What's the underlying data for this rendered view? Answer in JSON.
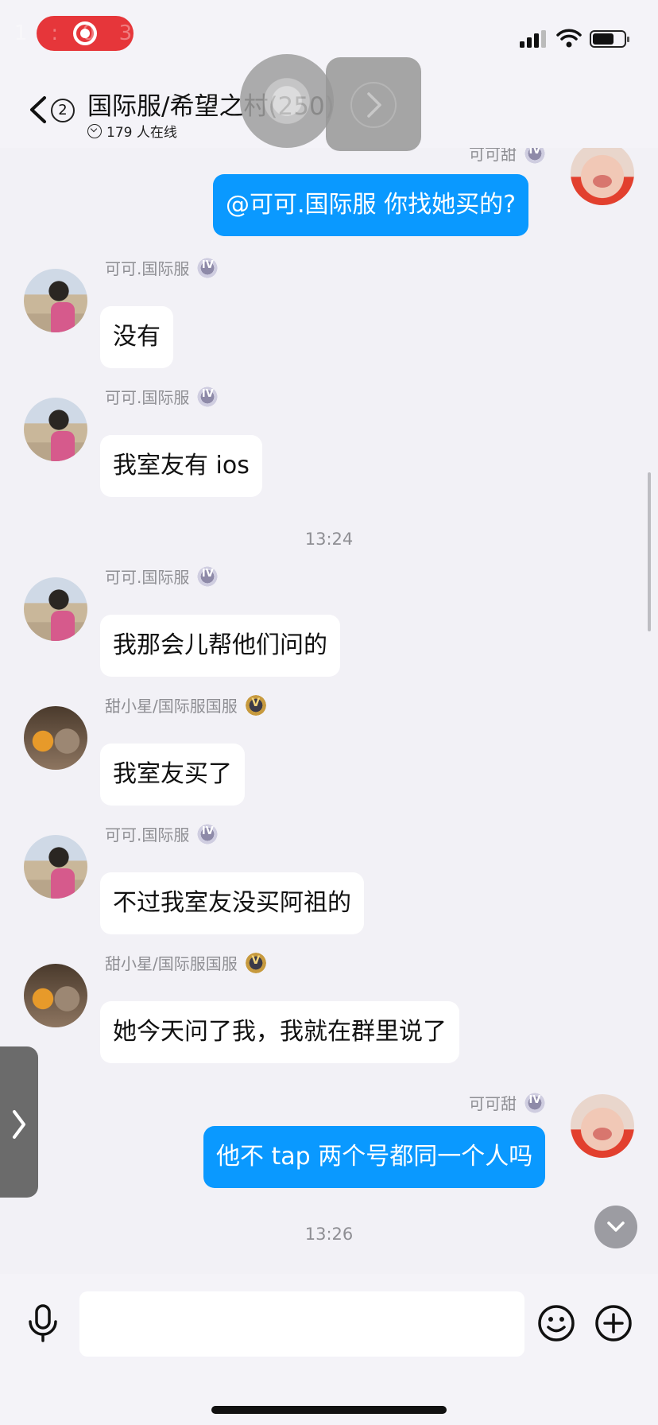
{
  "status_bar": {
    "recording_label": "1:03"
  },
  "header": {
    "unread_count": "2",
    "title": "国际服/希望之村(250)",
    "online": "179 人在线"
  },
  "chat": {
    "partial_sender": "可可甜",
    "messages": [
      {
        "side": "out",
        "sender": "",
        "badge": "silver",
        "avatar": "me",
        "text": "@可可.国际服 你找她买的?"
      },
      {
        "side": "in",
        "sender": "可可.国际服",
        "badge": "silver",
        "avatar": "koko",
        "text": "没有"
      },
      {
        "side": "in",
        "sender": "可可.国际服",
        "badge": "silver",
        "avatar": "koko",
        "text": "我室友有 ios"
      },
      {
        "time": "13:24"
      },
      {
        "side": "in",
        "sender": "可可.国际服",
        "badge": "silver",
        "avatar": "koko",
        "text": "我那会儿帮他们问的"
      },
      {
        "side": "in",
        "sender": "甜小星/国际服国服",
        "badge": "gold",
        "avatar": "tian",
        "text": "我室友买了"
      },
      {
        "side": "in",
        "sender": "可可.国际服",
        "badge": "silver",
        "avatar": "koko",
        "text": "不过我室友没买阿祖的"
      },
      {
        "side": "in",
        "sender": "甜小星/国际服国服",
        "badge": "gold",
        "avatar": "tian",
        "text": "她今天问了我，我就在群里说了"
      },
      {
        "side": "out",
        "sender": "可可甜",
        "badge": "silver",
        "avatar": "me",
        "text": "他不 tap 两个号都同一个人吗"
      },
      {
        "time": "13:26"
      }
    ]
  },
  "input": {
    "placeholder": ""
  }
}
